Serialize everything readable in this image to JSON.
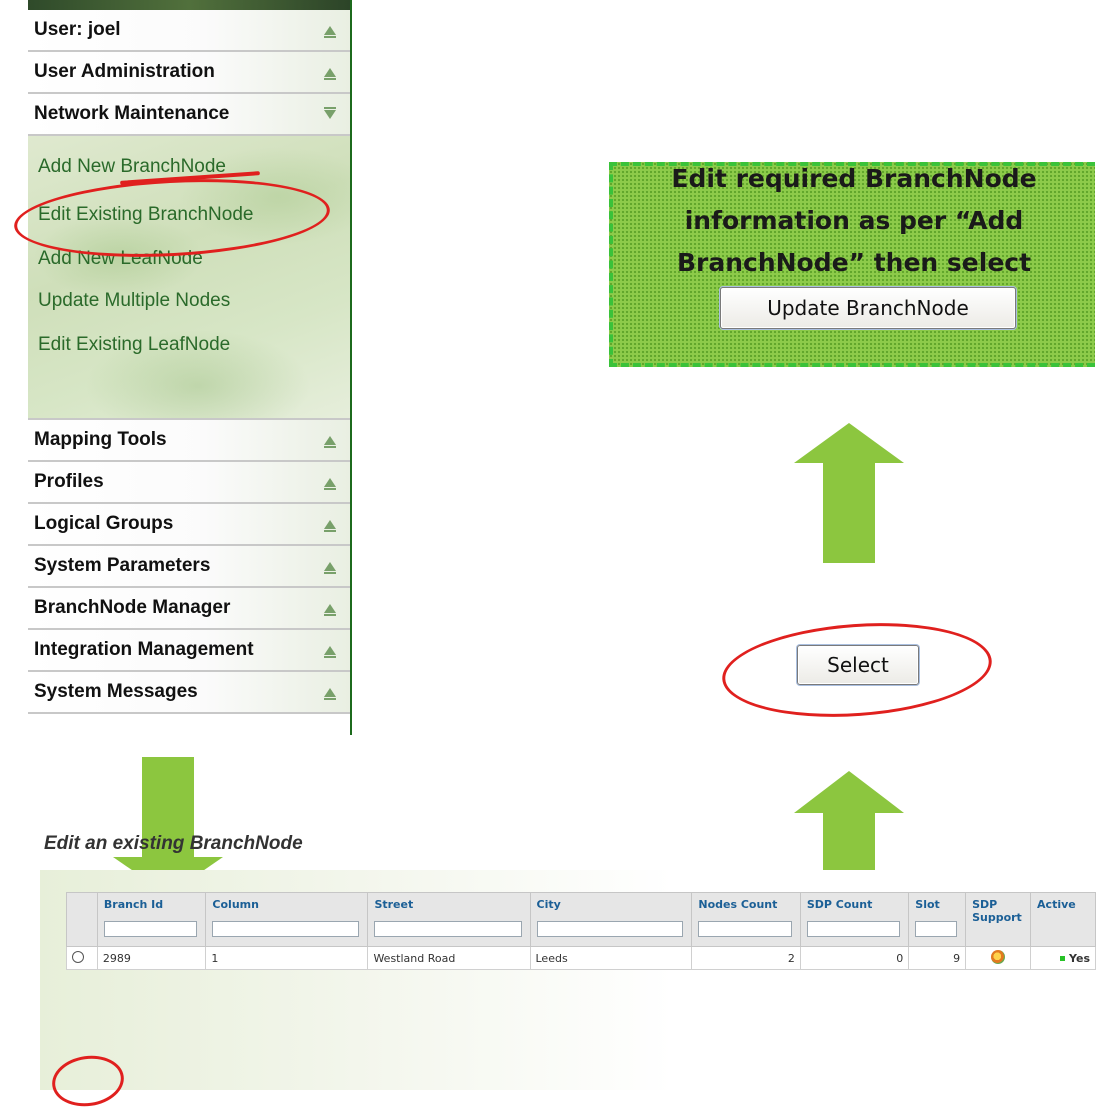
{
  "menu": {
    "sections_top": [
      {
        "label": "User: joel",
        "state": "collapsed"
      },
      {
        "label": "User Administration",
        "state": "collapsed"
      },
      {
        "label": "Network Maintenance",
        "state": "expanded"
      }
    ],
    "submenu": [
      "Add New BranchNode",
      "Edit Existing BranchNode",
      "Add New LeafNode",
      "Update Multiple Nodes",
      "Edit Existing LeafNode"
    ],
    "sections_bottom": [
      "Mapping Tools",
      "Profiles",
      "Logical Groups",
      "System Parameters",
      "BranchNode Manager",
      "Integration Management",
      "System Messages"
    ]
  },
  "callout": {
    "line1": "Edit required BranchNode",
    "line2": "information as per “Add",
    "line3": "BranchNode” then select",
    "update_button": "Update BranchNode"
  },
  "select_button": "Select",
  "table": {
    "title": "Edit an existing BranchNode",
    "columns": [
      "Branch Id",
      "Column",
      "Street",
      "City",
      "Nodes Count",
      "SDP Count",
      "Slot",
      "SDP Support",
      "Active"
    ],
    "row": {
      "branch_id": "2989",
      "column": "1",
      "street": "Westland Road",
      "city": "Leeds",
      "nodes_count": "2",
      "sdp_count": "0",
      "slot": "9",
      "active": "Yes"
    }
  },
  "colors": {
    "accent_green": "#8cc63f",
    "highlight_red": "#e0201e",
    "menu_border": "#1c6a1c",
    "header_blue": "#1b5f96"
  }
}
